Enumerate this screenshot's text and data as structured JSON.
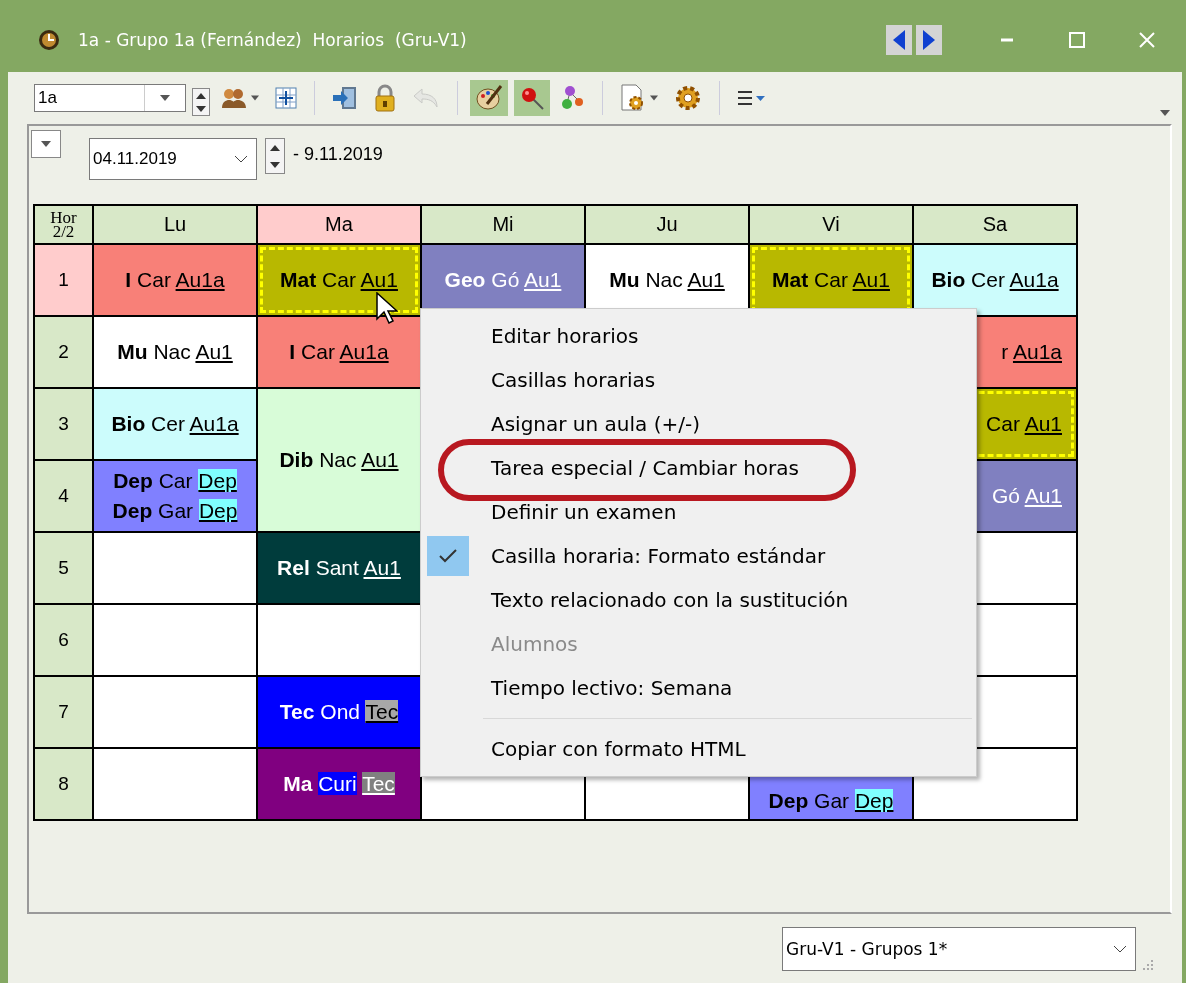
{
  "window": {
    "title": "1a - Grupo 1a (Fernández)  Horarios  (Gru-V1)"
  },
  "toolbar": {
    "class_select": {
      "value": "1a"
    },
    "tools": [
      {
        "kind": "people",
        "pressed": false,
        "disabled": false,
        "dropdown": true
      },
      {
        "kind": "grid",
        "pressed": false,
        "disabled": false,
        "dropdown": false
      },
      {
        "kind": "separator"
      },
      {
        "kind": "import",
        "pressed": false,
        "disabled": false,
        "dropdown": false
      },
      {
        "kind": "lock",
        "pressed": false,
        "disabled": false,
        "dropdown": false
      },
      {
        "kind": "undo",
        "pressed": false,
        "disabled": true,
        "dropdown": false
      },
      {
        "kind": "separator"
      },
      {
        "kind": "palette",
        "pressed": true,
        "disabled": false,
        "dropdown": false
      },
      {
        "kind": "pin",
        "pressed": true,
        "disabled": false,
        "dropdown": false
      },
      {
        "kind": "nodes",
        "pressed": false,
        "disabled": false,
        "dropdown": false
      },
      {
        "kind": "separator"
      },
      {
        "kind": "docgear",
        "pressed": false,
        "disabled": false,
        "dropdown": true
      },
      {
        "kind": "gear",
        "pressed": false,
        "disabled": false,
        "dropdown": false
      },
      {
        "kind": "separator"
      },
      {
        "kind": "list",
        "pressed": false,
        "disabled": false,
        "dropdown": false
      }
    ]
  },
  "date_bar": {
    "date": "04.11.2019",
    "end": "- 9.11.2019"
  },
  "timetable": {
    "corner": [
      "Hor",
      "2/2"
    ],
    "hours": [
      {
        "label": "1",
        "selected": true
      },
      {
        "label": "2",
        "selected": false
      },
      {
        "label": "3",
        "selected": false
      },
      {
        "label": "4",
        "selected": false
      },
      {
        "label": "5",
        "selected": false
      },
      {
        "label": "6",
        "selected": false
      },
      {
        "label": "7",
        "selected": false
      },
      {
        "label": "8",
        "selected": false
      }
    ],
    "days": [
      {
        "label": "Lu",
        "selected": false,
        "cells": [
          {
            "kind": "lesson",
            "color": "#f88078",
            "dashed": false,
            "double": false,
            "lines": [
              {
                "subject": "I",
                "teacher": {
                  "text": "Car"
                },
                "room": {
                  "text": "Au1a"
                }
              }
            ]
          },
          {
            "kind": "lesson",
            "color": "#ffffff",
            "dashed": false,
            "double": false,
            "lines": [
              {
                "subject": "Mu",
                "teacher": {
                  "text": "Nac"
                },
                "room": {
                  "text": "Au1"
                }
              }
            ]
          },
          {
            "kind": "lesson",
            "color": "#ccfcfc",
            "dashed": false,
            "double": false,
            "lines": [
              {
                "subject": "Bio",
                "teacher": {
                  "text": "Cer"
                },
                "room": {
                  "text": "Au1a"
                }
              }
            ]
          },
          {
            "kind": "lesson",
            "color": "#8080ff",
            "dashed": false,
            "double": false,
            "lines": [
              {
                "subject": "Dep",
                "teacher": {
                  "text": "Car"
                },
                "room": {
                  "text": "Dep",
                  "color": "#80ffff"
                }
              },
              {
                "subject": "Dep",
                "teacher": {
                  "text": "Gar"
                },
                "room": {
                  "text": "Dep",
                  "color": "#80ffff"
                }
              }
            ]
          },
          {
            "kind": "empty"
          },
          {
            "kind": "empty"
          },
          {
            "kind": "empty"
          },
          {
            "kind": "empty"
          }
        ]
      },
      {
        "label": "Ma",
        "selected": true,
        "cells": [
          {
            "kind": "lesson",
            "color": "#b8b800",
            "dashed": true,
            "double": false,
            "lines": [
              {
                "subject": "Mat",
                "teacher": {
                  "text": "Car"
                },
                "room": {
                  "text": "Au1"
                }
              }
            ]
          },
          {
            "kind": "lesson",
            "color": "#f88078",
            "dashed": false,
            "double": false,
            "lines": [
              {
                "subject": "I",
                "teacher": {
                  "text": "Car"
                },
                "room": {
                  "text": "Au1a"
                }
              }
            ]
          },
          {
            "kind": "lesson",
            "color": "#d8fcd8",
            "dashed": false,
            "double": true,
            "lines": [
              {
                "subject": "Dib",
                "teacher": {
                  "text": "Nac"
                },
                "room": {
                  "text": "Au1"
                }
              }
            ]
          },
          {
            "kind": "lesson",
            "color": "#003c3c",
            "dashed": false,
            "double": false,
            "lines": [
              {
                "subject": "Rel",
                "teacher": {
                  "text": "Sant"
                },
                "room": {
                  "text": "Au1"
                }
              }
            ]
          },
          {
            "kind": "empty"
          },
          {
            "kind": "lesson",
            "color": "#0000ff",
            "dashed": false,
            "double": false,
            "lines": [
              {
                "subject": "Tec",
                "teacher": {
                  "text": "Ond"
                },
                "room": {
                  "text": "Tec",
                  "color": "#a8a8a8"
                }
              }
            ]
          },
          {
            "kind": "lesson",
            "color": "#800080",
            "dashed": false,
            "double": false,
            "lines": [
              {
                "subject": "Ma",
                "teacher": {
                  "text": "Curi",
                  "color": "#0000ff"
                },
                "room": {
                  "text": "Tec",
                  "color": "#808080"
                }
              }
            ]
          }
        ]
      },
      {
        "label": "Mi",
        "selected": false,
        "cells": [
          {
            "kind": "lesson",
            "color": "#8080c0",
            "dashed": false,
            "double": false,
            "lines": [
              {
                "subject": "Geo",
                "teacher": {
                  "text": "Gó"
                },
                "room": {
                  "text": "Au1"
                }
              }
            ]
          },
          {
            "kind": "covered"
          },
          {
            "kind": "covered"
          },
          {
            "kind": "covered"
          },
          {
            "kind": "covered"
          },
          {
            "kind": "covered"
          },
          {
            "kind": "covered"
          },
          {
            "kind": "empty"
          }
        ]
      },
      {
        "label": "Ju",
        "selected": false,
        "cells": [
          {
            "kind": "lesson",
            "color": "#ffffff",
            "dashed": false,
            "double": false,
            "lines": [
              {
                "subject": "Mu",
                "teacher": {
                  "text": "Nac"
                },
                "room": {
                  "text": "Au1"
                }
              }
            ]
          },
          {
            "kind": "covered"
          },
          {
            "kind": "covered"
          },
          {
            "kind": "covered"
          },
          {
            "kind": "covered"
          },
          {
            "kind": "covered"
          },
          {
            "kind": "covered"
          },
          {
            "kind": "empty"
          }
        ]
      },
      {
        "label": "Vi",
        "selected": false,
        "cells": [
          {
            "kind": "lesson",
            "color": "#b8b800",
            "dashed": true,
            "double": false,
            "lines": [
              {
                "subject": "Mat",
                "teacher": {
                  "text": "Car"
                },
                "room": {
                  "text": "Au1"
                }
              }
            ]
          },
          {
            "kind": "covered"
          },
          {
            "kind": "covered"
          },
          {
            "kind": "covered"
          },
          {
            "kind": "covered"
          },
          {
            "kind": "covered"
          },
          {
            "kind": "covered"
          },
          {
            "kind": "lesson",
            "color": "#8080ff",
            "dashed": false,
            "double": false,
            "cut_top": true,
            "lines": [
              {
                "subject": "Dep",
                "teacher": {
                  "text": "Gar"
                },
                "room": {
                  "text": "Dep",
                  "color": "#80ffff"
                }
              }
            ]
          }
        ]
      },
      {
        "label": "Sa",
        "selected": false,
        "cells": [
          {
            "kind": "lesson",
            "color": "#ccfcfc",
            "dashed": false,
            "double": false,
            "lines": [
              {
                "subject": "Bio",
                "teacher": {
                  "text": "Cer"
                },
                "room": {
                  "text": "Au1a"
                }
              }
            ]
          },
          {
            "kind": "lesson",
            "color": "#f88078",
            "dashed": false,
            "double": false,
            "cut_left": true,
            "lines": [
              {
                "teacher": {
                  "text": "r"
                },
                "room": {
                  "text": "Au1a"
                }
              }
            ]
          },
          {
            "kind": "lesson",
            "color": "#b8b800",
            "dashed": true,
            "double": false,
            "cut_left": true,
            "lines": [
              {
                "teacher": {
                  "text": "Car"
                },
                "room": {
                  "text": "Au1"
                }
              }
            ]
          },
          {
            "kind": "lesson",
            "color": "#8080c0",
            "dashed": false,
            "double": false,
            "cut_left": true,
            "lines": [
              {
                "teacher": {
                  "text": "Gó"
                },
                "room": {
                  "text": "Au1"
                }
              }
            ]
          },
          {
            "kind": "empty"
          },
          {
            "kind": "empty"
          },
          {
            "kind": "empty"
          },
          {
            "kind": "empty"
          }
        ]
      }
    ]
  },
  "context_menu": {
    "items": [
      {
        "kind": "item",
        "label": "Editar horarios",
        "checked": false,
        "disabled": false
      },
      {
        "kind": "item",
        "label": "Casillas horarias",
        "checked": false,
        "disabled": false
      },
      {
        "kind": "item",
        "label": "Asignar un aula (+/-)",
        "checked": false,
        "disabled": false
      },
      {
        "kind": "item",
        "label": "Tarea especial / Cambiar horas",
        "checked": false,
        "disabled": false,
        "annotated": true
      },
      {
        "kind": "item",
        "label": "Definir un examen",
        "checked": false,
        "disabled": false
      },
      {
        "kind": "item",
        "label": "Casilla horaria: Formato estándar",
        "checked": true,
        "disabled": false
      },
      {
        "kind": "item",
        "label": "Texto relacionado con la sustitución",
        "checked": false,
        "disabled": false
      },
      {
        "kind": "item",
        "label": "Alumnos",
        "checked": false,
        "disabled": true
      },
      {
        "kind": "item",
        "label": "Tiempo lectivo: Semana",
        "checked": false,
        "disabled": false
      },
      {
        "kind": "separator"
      },
      {
        "kind": "item",
        "label": "Copiar con formato HTML",
        "checked": false,
        "disabled": false
      }
    ]
  },
  "footer": {
    "view_select": {
      "value": "Gru-V1 - Grupos 1*"
    }
  }
}
